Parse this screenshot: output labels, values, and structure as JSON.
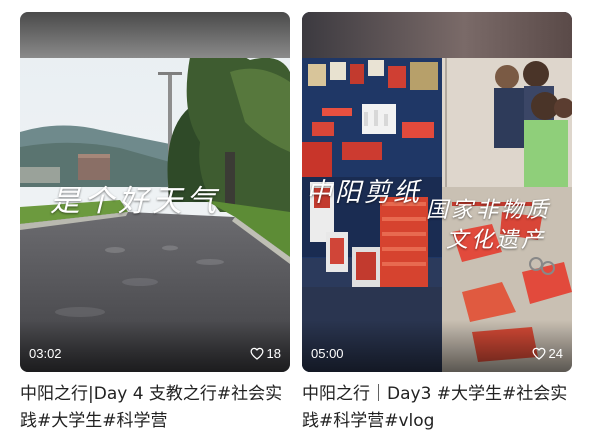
{
  "cards": [
    {
      "caption": "是个好天气",
      "duration": "03:02",
      "likes": "18",
      "title": "中阳之行|Day 4 支教之行#社会实践#大学生#科学营"
    },
    {
      "caption_left": "中阳剪纸",
      "caption_right_line1": "国家非物质",
      "caption_right_line2": "文化遗产",
      "duration": "05:00",
      "likes": "24",
      "title": "中阳之行｜Day3 #大学生#社会实践#科学营#vlog"
    }
  ],
  "colors": {
    "text": "#222222",
    "overlay_text": "#ffffff"
  },
  "icons": {
    "like": "heart-outline-icon"
  }
}
